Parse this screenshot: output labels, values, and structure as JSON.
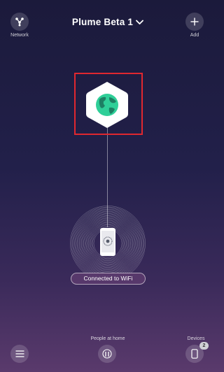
{
  "header": {
    "network_label": "Network",
    "title": "Plume Beta 1",
    "add_label": "Add",
    "icons": {
      "network": "network-topology-icon",
      "add": "plus-icon",
      "title_dropdown": "chevron-down-icon"
    }
  },
  "topology": {
    "gateway_icon": "globe-icon",
    "device_icon": "smartphone-icon",
    "status_text": "Connected to WiFi"
  },
  "footer": {
    "people_label": "People at home",
    "devices_label": "Devices",
    "devices_count": "2",
    "icons": {
      "menu": "hamburger-menu-icon",
      "people": "people-icon",
      "devices": "phone-icon"
    }
  },
  "colors": {
    "highlight": "#e0272f",
    "globe": "#2fcf98",
    "background_top": "#1b1a3b",
    "background_bottom": "#5a3a6c"
  }
}
